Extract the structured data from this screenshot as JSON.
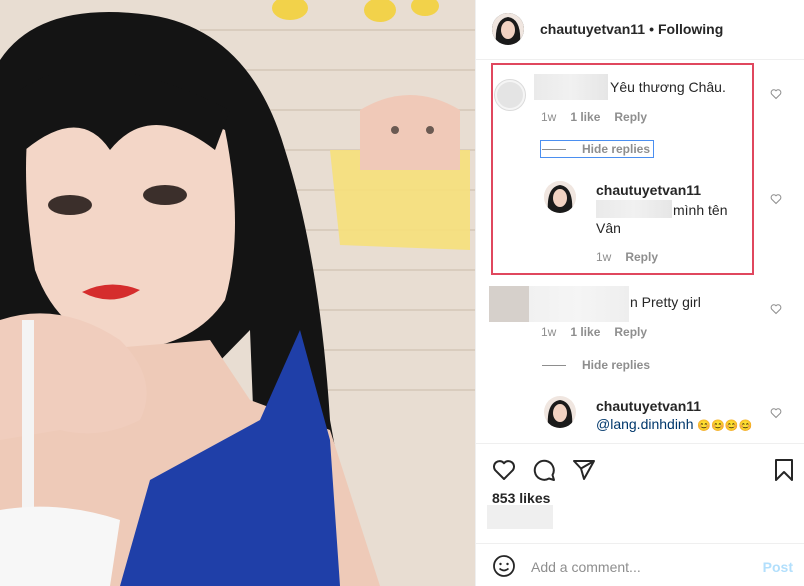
{
  "header": {
    "username": "chautuyetvan11",
    "separator": "•",
    "follow_status": "Following"
  },
  "comments": [
    {
      "text": "Yêu thương Châu.",
      "time": "1w",
      "likes": "1 like",
      "reply_label": "Reply",
      "hide_replies_label": "Hide replies",
      "replies": [
        {
          "username": "chautuyetvan11",
          "text_line1": "mình tên",
          "text_line2": "Vân",
          "time": "1w",
          "reply_label": "Reply"
        }
      ]
    },
    {
      "text": "n Pretty girl",
      "time": "1w",
      "likes": "1 like",
      "reply_label": "Reply",
      "hide_replies_label": "Hide replies",
      "replies": [
        {
          "username": "chautuyetvan11",
          "mention": "@lang.dinhdinh",
          "emoji": "😊😊😊😊"
        }
      ]
    }
  ],
  "post": {
    "likes": "853 likes"
  },
  "add_comment": {
    "placeholder": "Add a comment...",
    "post_label": "Post"
  },
  "colors": {
    "highlight_box": "#e0475e",
    "hide_replies_outline": "#4b8ff0",
    "post_button": "#b2dffc",
    "mention": "#00376b"
  },
  "icons": [
    "heart-icon",
    "comment-icon",
    "share-icon",
    "bookmark-icon",
    "emoji-icon",
    "like-comment-heart-icon"
  ]
}
